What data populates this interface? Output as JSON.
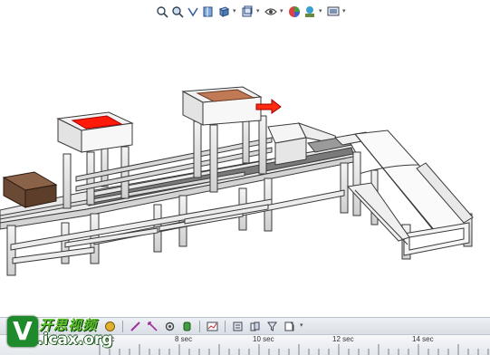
{
  "view_toolbar": {
    "icons": [
      "zoom-to-fit-icon",
      "zoom-area-icon",
      "previous-view-icon",
      "section-view-icon",
      "view-orientation-icon",
      "display-style-icon",
      "hide-show-items-icon",
      "edit-appearance-icon",
      "apply-scene-icon",
      "view-settings-icon"
    ]
  },
  "motion_toolbar": {
    "icons": [
      "calculate-icon",
      "motor-icon",
      "spring-icon",
      "damper-icon",
      "force-icon",
      "contact-icon",
      "gravity-icon",
      "results-plots-icon",
      "motion-study-properties-icon",
      "collapse-icon",
      "filter-icon",
      "view-icon"
    ]
  },
  "timeline": {
    "labels": [
      "sec",
      "8 sec",
      "10 sec",
      "12 sec",
      "14 sec"
    ]
  },
  "watermark": {
    "logo_letter": "V",
    "chinese_text": "开思视频",
    "url_text": ".icax.org"
  },
  "colors": {
    "accent_red": "#ff1a0a",
    "plate_brown": "#c07a55",
    "box_brown": "#6b4a35",
    "watermark_green": "#1f8a2c"
  }
}
